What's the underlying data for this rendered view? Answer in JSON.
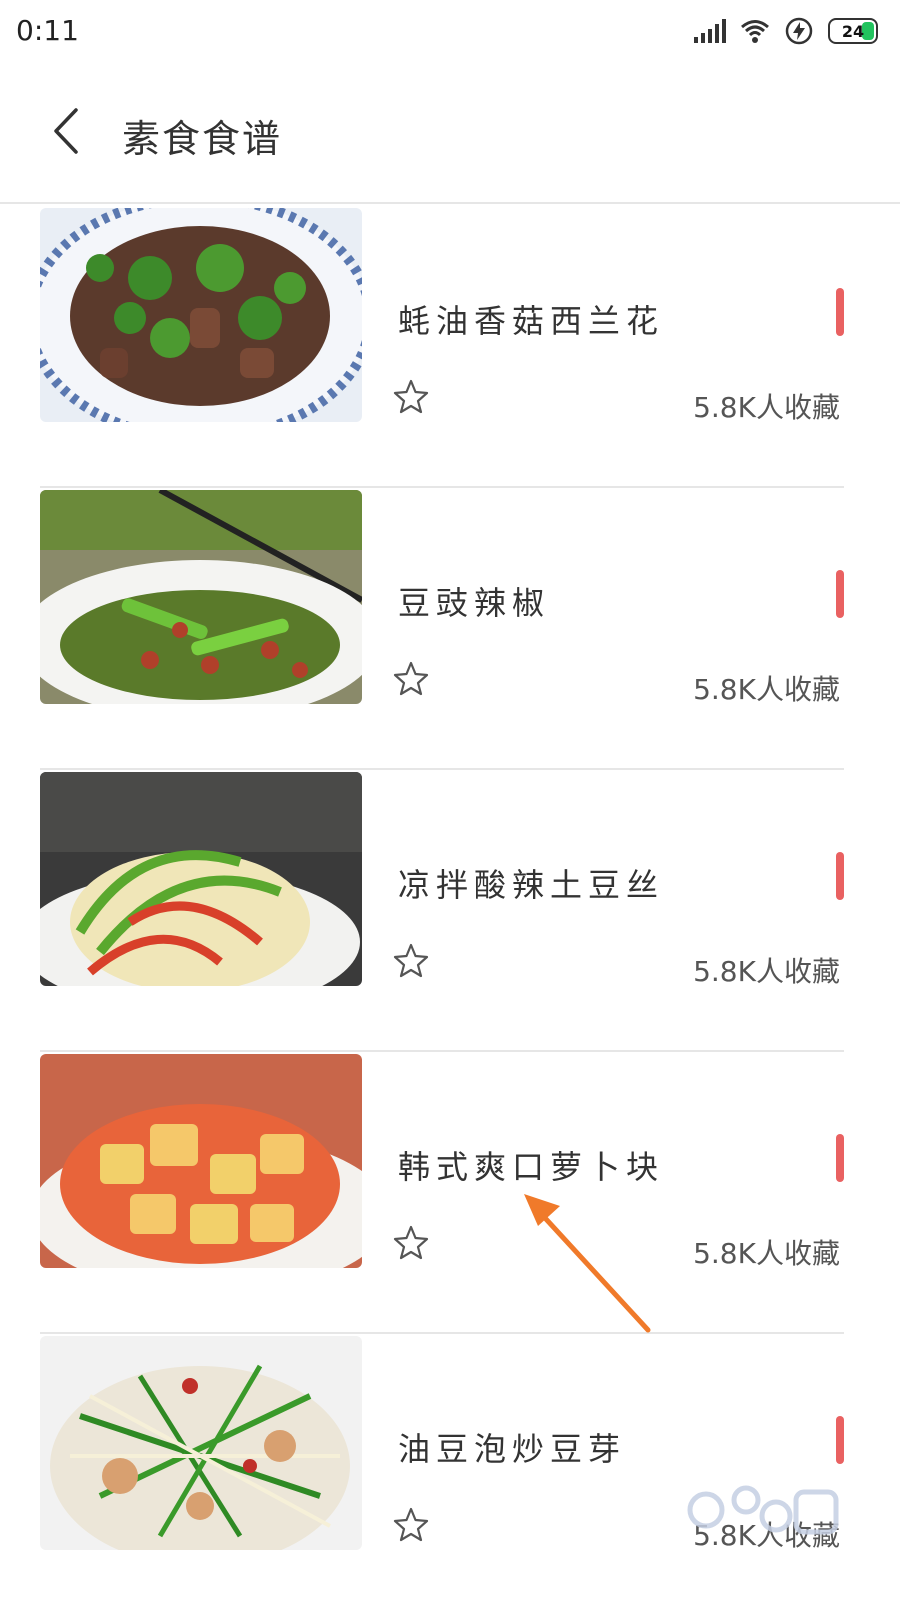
{
  "status_bar": {
    "time": "0:11",
    "battery_level": "24",
    "icons": [
      "signal-icon",
      "wifi-icon",
      "charging-icon",
      "battery-icon"
    ]
  },
  "header": {
    "back_icon": "chevron-left-icon",
    "title": "素食食谱"
  },
  "recipes": [
    {
      "name": "蚝油香菇西兰花",
      "favorites": "5.8K人收藏",
      "image": "broccoli-mushroom-dish"
    },
    {
      "name": "豆豉辣椒",
      "favorites": "5.8K人收藏",
      "image": "pepper-peanut-dish"
    },
    {
      "name": "凉拌酸辣土豆丝",
      "favorites": "5.8K人收藏",
      "image": "shredded-potato-dish"
    },
    {
      "name": "韩式爽口萝卜块",
      "favorites": "5.8K人收藏",
      "image": "radish-cube-dish"
    },
    {
      "name": "油豆泡炒豆芽",
      "favorites": "5.8K人收藏",
      "image": "bean-sprout-dish"
    }
  ],
  "colors": {
    "accent": "#e96161",
    "divider": "#e6e6e6",
    "annotation_arrow": "#f07a2a"
  }
}
